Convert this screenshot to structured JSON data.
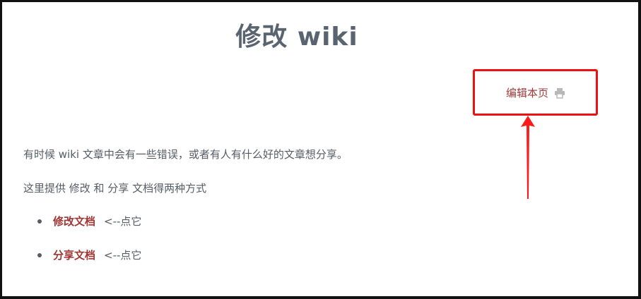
{
  "title": "修改 wiki",
  "edit_link": {
    "label": "编辑本页",
    "icon": "printer-icon"
  },
  "paragraphs": [
    "有时候 wiki 文章中会有一些错误，或者有人有什么好的文章想分享。",
    "这里提供 修改 和 分享 文档得两种方式"
  ],
  "list": [
    {
      "link": "修改文档",
      "hint": "<--点它"
    },
    {
      "link": "分享文档",
      "hint": "<--点它"
    }
  ],
  "colors": {
    "title": "#596470",
    "link": "#a03535",
    "highlight": "#ee1111"
  }
}
